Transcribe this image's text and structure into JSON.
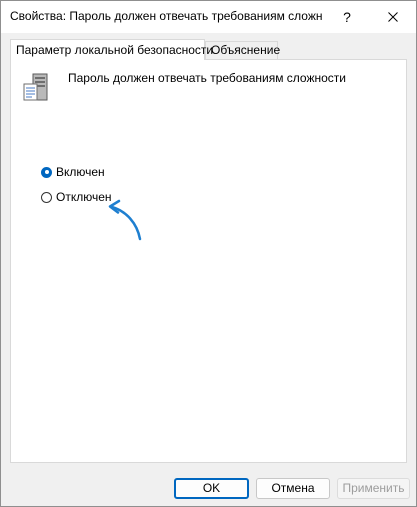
{
  "window": {
    "title": "Свойства: Пароль должен отвечать требованиям сложн",
    "help_glyph": "?",
    "close_glyph": "✕"
  },
  "tabs": [
    {
      "label": "Параметр локальной безопасности",
      "active": true
    },
    {
      "label": "Объяснение",
      "active": false
    }
  ],
  "policy": {
    "icon": "server-policy-icon",
    "title": "Пароль должен отвечать требованиям сложности"
  },
  "options": [
    {
      "label": "Включен",
      "selected": true
    },
    {
      "label": "Отключен",
      "selected": false
    }
  ],
  "annotation": {
    "icon": "curved-arrow-icon",
    "color": "#1e7fd0"
  },
  "buttons": {
    "ok": "OK",
    "cancel": "Отмена",
    "apply": "Применить"
  },
  "colors": {
    "accent": "#0067c0",
    "disabled_text": "#9d9d9d"
  }
}
